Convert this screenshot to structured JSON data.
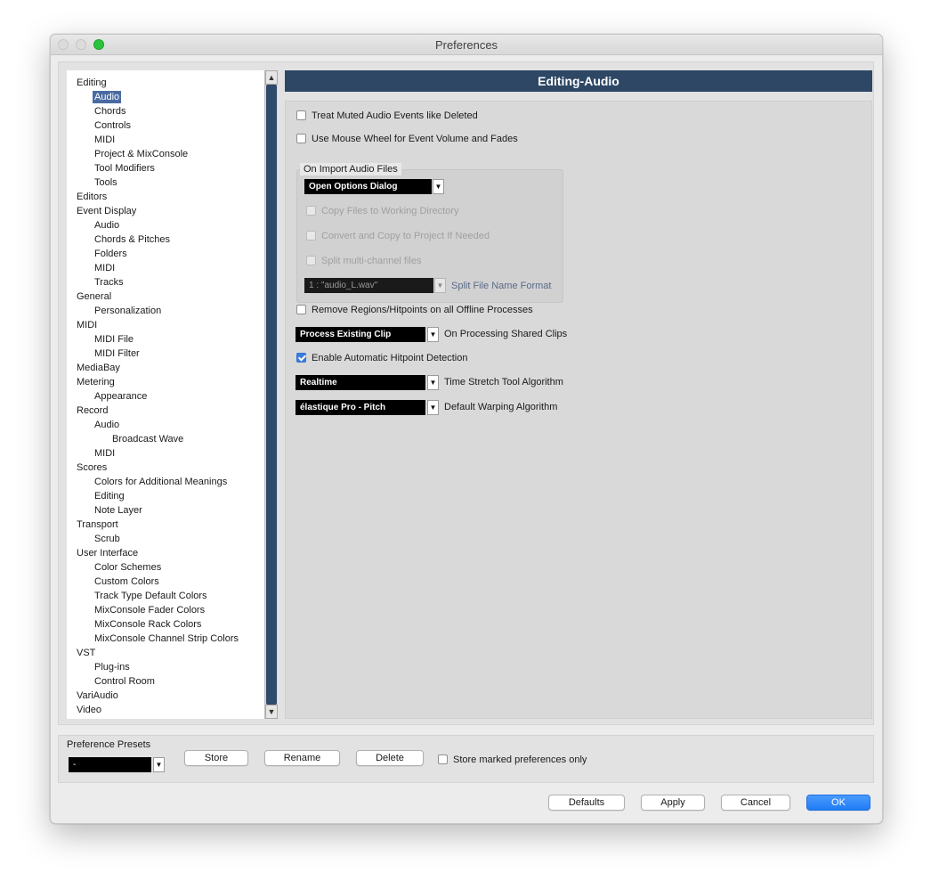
{
  "window": {
    "title": "Preferences"
  },
  "tree": [
    {
      "label": "Editing",
      "level": 0
    },
    {
      "label": "Audio",
      "level": 1,
      "selected": true
    },
    {
      "label": "Chords",
      "level": 1
    },
    {
      "label": "Controls",
      "level": 1
    },
    {
      "label": "MIDI",
      "level": 1
    },
    {
      "label": "Project & MixConsole",
      "level": 1
    },
    {
      "label": "Tool Modifiers",
      "level": 1
    },
    {
      "label": "Tools",
      "level": 1
    },
    {
      "label": "Editors",
      "level": 0
    },
    {
      "label": "Event Display",
      "level": 0
    },
    {
      "label": "Audio",
      "level": 1
    },
    {
      "label": "Chords & Pitches",
      "level": 1
    },
    {
      "label": "Folders",
      "level": 1
    },
    {
      "label": "MIDI",
      "level": 1
    },
    {
      "label": "Tracks",
      "level": 1
    },
    {
      "label": "General",
      "level": 0
    },
    {
      "label": "Personalization",
      "level": 1
    },
    {
      "label": "MIDI",
      "level": 0
    },
    {
      "label": "MIDI File",
      "level": 1
    },
    {
      "label": "MIDI Filter",
      "level": 1
    },
    {
      "label": "MediaBay",
      "level": 0
    },
    {
      "label": "Metering",
      "level": 0
    },
    {
      "label": "Appearance",
      "level": 1
    },
    {
      "label": "Record",
      "level": 0
    },
    {
      "label": "Audio",
      "level": 1
    },
    {
      "label": "Broadcast Wave",
      "level": 2
    },
    {
      "label": "MIDI",
      "level": 1
    },
    {
      "label": "Scores",
      "level": 0
    },
    {
      "label": "Colors for Additional Meanings",
      "level": 1
    },
    {
      "label": "Editing",
      "level": 1
    },
    {
      "label": "Note Layer",
      "level": 1
    },
    {
      "label": "Transport",
      "level": 0
    },
    {
      "label": "Scrub",
      "level": 1
    },
    {
      "label": "User Interface",
      "level": 0
    },
    {
      "label": "Color Schemes",
      "level": 1
    },
    {
      "label": "Custom Colors",
      "level": 1
    },
    {
      "label": "Track Type Default Colors",
      "level": 1
    },
    {
      "label": "MixConsole Fader Colors",
      "level": 1
    },
    {
      "label": "MixConsole Rack Colors",
      "level": 1
    },
    {
      "label": "MixConsole Channel Strip Colors",
      "level": 1
    },
    {
      "label": "VST",
      "level": 0
    },
    {
      "label": "Plug-ins",
      "level": 1
    },
    {
      "label": "Control Room",
      "level": 1
    },
    {
      "label": "VariAudio",
      "level": 0
    },
    {
      "label": "Video",
      "level": 0
    }
  ],
  "section": {
    "title": "Editing-Audio",
    "treat_muted": {
      "label": "Treat Muted Audio Events like Deleted",
      "checked": false
    },
    "mouse_wheel": {
      "label": "Use Mouse Wheel for Event Volume and Fades",
      "checked": false
    },
    "import_group": {
      "title": "On Import Audio Files",
      "mode_value": "Open Options Dialog",
      "copy_files": {
        "label": "Copy Files to Working Directory",
        "checked": false
      },
      "convert_copy": {
        "label": "Convert and Copy to Project If Needed",
        "checked": false
      },
      "split_multi": {
        "label": "Split multi-channel files",
        "checked": false
      },
      "split_format_value": "1 : \"audio_L.wav\"",
      "split_format_label": "Split File Name Format"
    },
    "remove_regions": {
      "label": "Remove Regions/Hitpoints on all Offline Processes",
      "checked": false
    },
    "shared_clips": {
      "value": "Process Existing Clip",
      "label": "On Processing Shared Clips"
    },
    "hitpoint": {
      "label": "Enable Automatic Hitpoint Detection",
      "checked": true
    },
    "time_stretch": {
      "value": "Realtime",
      "label": "Time Stretch Tool Algorithm"
    },
    "warping": {
      "value": "élastique Pro - Pitch",
      "label": "Default Warping Algorithm"
    }
  },
  "presets": {
    "label": "Preference Presets",
    "value": "-",
    "store": "Store",
    "rename": "Rename",
    "delete": "Delete",
    "marked_only": {
      "label": "Store marked preferences only",
      "checked": false
    }
  },
  "footer": {
    "defaults": "Defaults",
    "apply": "Apply",
    "cancel": "Cancel",
    "ok": "OK"
  }
}
